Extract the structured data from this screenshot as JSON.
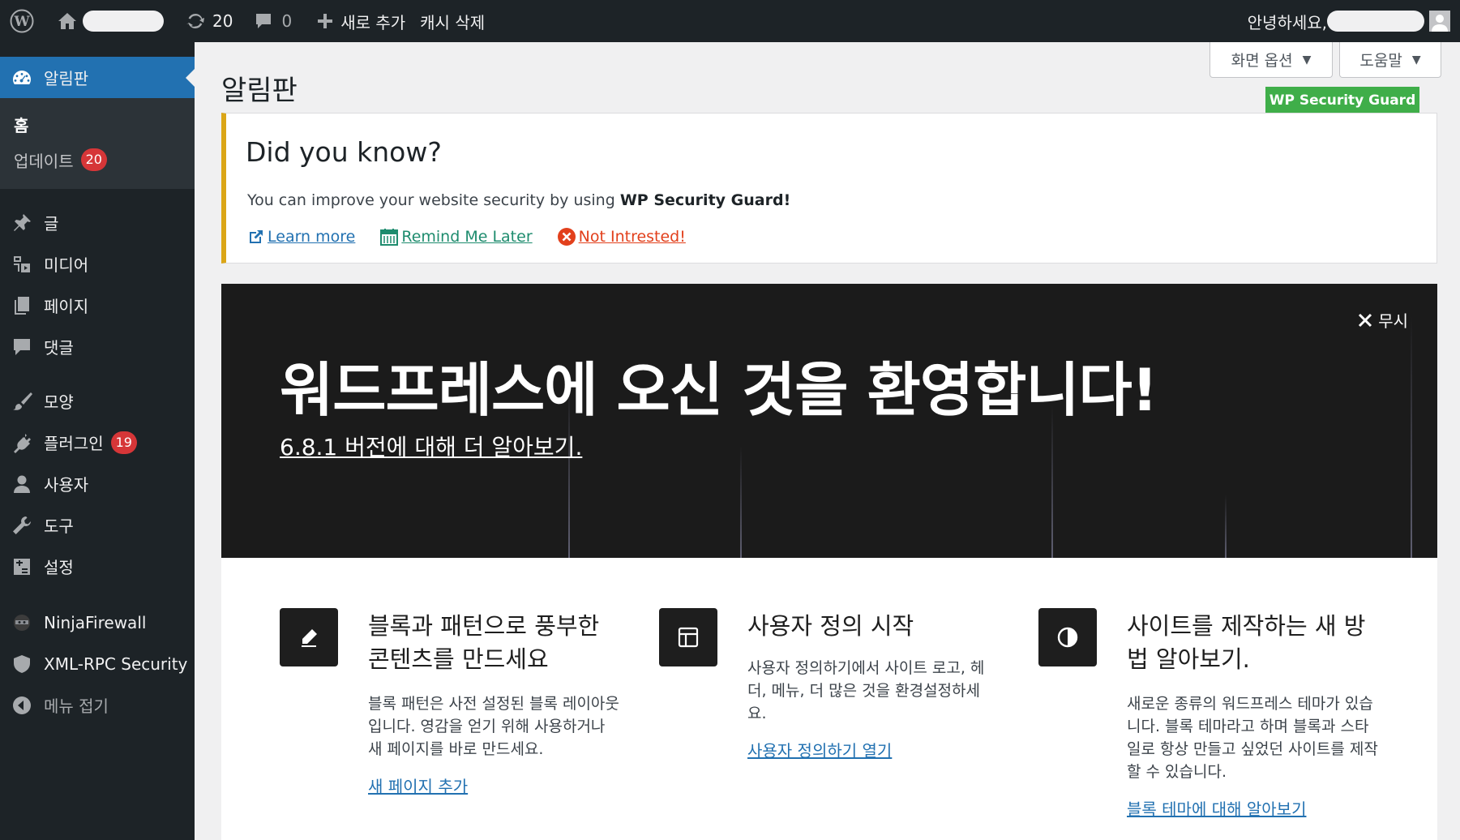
{
  "admin_bar": {
    "wp_logo": "wordpress-icon",
    "home_icon": "home-icon",
    "updates_count": "20",
    "comments_count": "0",
    "new_label": "새로 추가",
    "cache_label": "캐시 삭제",
    "greeting": "안녕하세요,"
  },
  "sidebar": {
    "dashboard": "알림판",
    "home": "홈",
    "updates": "업데이트",
    "updates_badge": "20",
    "posts": "글",
    "media": "미디어",
    "pages": "페이지",
    "comments": "댓글",
    "appearance": "모양",
    "plugins": "플러그인",
    "plugins_badge": "19",
    "users": "사용자",
    "tools": "도구",
    "settings": "설정",
    "ninjafirewall": "NinjaFirewall",
    "xmlrpc": "XML-RPC Security",
    "collapse": "메뉴 접기"
  },
  "screen_options": "화면 옵션",
  "help": "도움말",
  "page_title": "알림판",
  "wpsg_tag": "WP Security Guard",
  "notice": {
    "title": "Did you know?",
    "text_prefix": "You can improve your website security by using ",
    "text_bold": "WP Security Guard!",
    "learn_more": "Learn more",
    "remind_later": "Remind Me Later",
    "not_interested": "Not Intrested!"
  },
  "welcome": {
    "dismiss": "무시",
    "heading": "워드프레스에 오신 것을 환영합니다!",
    "version_link": "6.8.1 버전에 대해 더 알아보기."
  },
  "columns": [
    {
      "heading": "블록과 패턴으로 풍부한 콘텐츠를 만드세요",
      "text": "블록 패턴은 사전 설정된 블록 레이아웃입니다. 영감을 얻기 위해 사용하거나 새 페이지를 바로 만드세요.",
      "link": "새 페이지 추가"
    },
    {
      "heading": "사용자 정의 시작",
      "text": "사용자 정의하기에서 사이트 로고, 헤더, 메뉴, 더 많은 것을 환경설정하세요.",
      "link": "사용자 정의하기 열기"
    },
    {
      "heading": "사이트를 제작하는 새 방법 알아보기.",
      "text": "새로운 종류의 워드프레스 테마가 있습니다. 블록 테마라고 하며 블록과 스타일로 항상 만들고 싶었던 사이트를 제작할 수 있습니다.",
      "link": "블록 테마에 대해 알아보기"
    }
  ],
  "colors": {
    "admin_dark": "#1d2327",
    "accent_blue": "#2271b1",
    "badge_red": "#d63638",
    "notice_yellow": "#dba617",
    "wpsg_green": "#3fae49"
  }
}
